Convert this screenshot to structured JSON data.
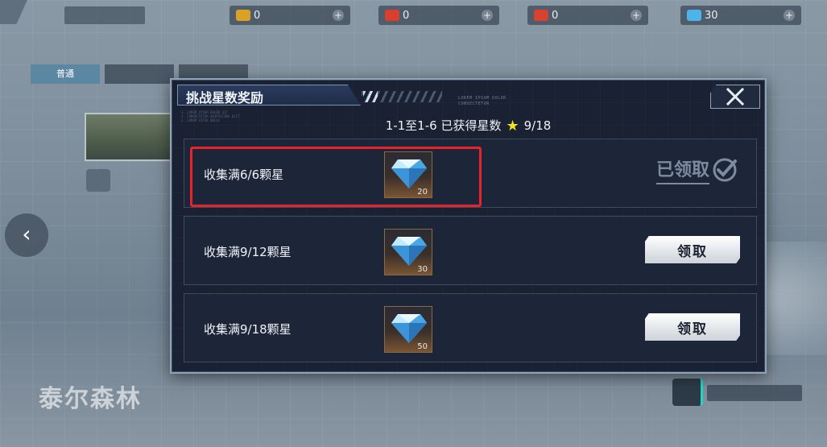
{
  "topbar": {
    "resources": [
      {
        "value": "0",
        "color": "#d9a227",
        "icon": "gold-crate-icon"
      },
      {
        "value": "0",
        "color": "#d93f30",
        "icon": "red-crate-icon"
      },
      {
        "value": "0",
        "color": "#d7432f",
        "icon": "red-supply-icon"
      },
      {
        "value": "30",
        "color": "#4db3e8",
        "icon": "diamond-icon"
      }
    ]
  },
  "background": {
    "map_title": "泰尔森林",
    "difficulty_tabs": [
      "普通",
      "",
      ""
    ]
  },
  "dialog": {
    "title": "挑战星数奖励",
    "summary_prefix": "1-1至1-6 已获得星数",
    "summary_value": "9/18",
    "rewards": [
      {
        "label": "收集满6/6颗星",
        "count": "20",
        "status": "已领取",
        "item_icon": "diamond-icon"
      },
      {
        "label": "收集满9/12颗星",
        "count": "30",
        "status": "领取",
        "item_icon": "diamond-icon"
      },
      {
        "label": "收集满9/18颗星",
        "count": "50",
        "status": "领取",
        "item_icon": "diamond-icon"
      }
    ]
  },
  "colors": {
    "dialog_bg": "#1a2133",
    "highlight": "#e8232a",
    "star": "#f3e31d"
  }
}
